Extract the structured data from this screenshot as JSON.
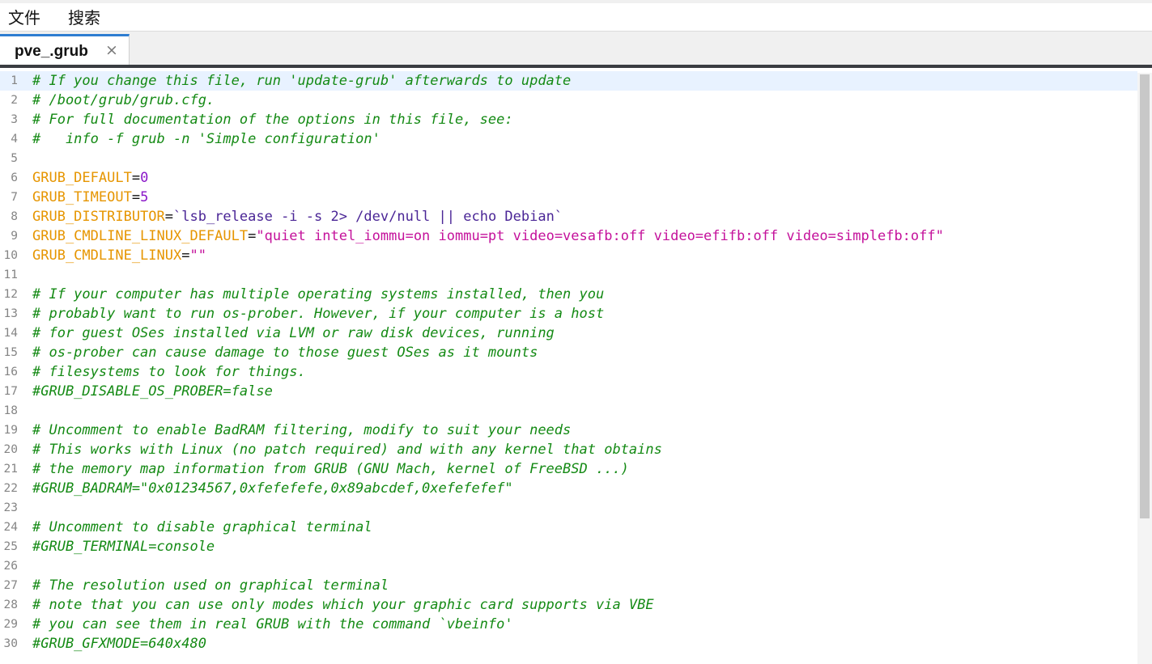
{
  "menu": {
    "file": "文件",
    "search": "搜索"
  },
  "tab": {
    "label": "pve_.grub",
    "close": "×"
  },
  "lines": [
    {
      "n": "1",
      "segs": [
        {
          "t": "# If you change this file, run 'update-grub' afterwards to update",
          "c": "comment"
        }
      ]
    },
    {
      "n": "2",
      "segs": [
        {
          "t": "# /boot/grub/grub.cfg.",
          "c": "comment"
        }
      ]
    },
    {
      "n": "3",
      "segs": [
        {
          "t": "# For full documentation of the options in this file, see:",
          "c": "comment"
        }
      ]
    },
    {
      "n": "4",
      "segs": [
        {
          "t": "#   info -f grub -n 'Simple configuration'",
          "c": "comment"
        }
      ]
    },
    {
      "n": "5",
      "segs": []
    },
    {
      "n": "6",
      "segs": [
        {
          "t": "GRUB_DEFAULT",
          "c": "key"
        },
        {
          "t": "=",
          "c": "op"
        },
        {
          "t": "0",
          "c": "num"
        }
      ]
    },
    {
      "n": "7",
      "segs": [
        {
          "t": "GRUB_TIMEOUT",
          "c": "key"
        },
        {
          "t": "=",
          "c": "op"
        },
        {
          "t": "5",
          "c": "num"
        }
      ]
    },
    {
      "n": "8",
      "segs": [
        {
          "t": "GRUB_DISTRIBUTOR",
          "c": "key"
        },
        {
          "t": "=",
          "c": "op"
        },
        {
          "t": "`lsb_release -i -s 2> /dev/null || echo Debian`",
          "c": "tick"
        }
      ]
    },
    {
      "n": "9",
      "segs": [
        {
          "t": "GRUB_CMDLINE_LINUX_DEFAULT",
          "c": "key"
        },
        {
          "t": "=",
          "c": "op"
        },
        {
          "t": "\"quiet intel_iommu=on iommu=pt video=vesafb:off video=efifb:off video=simplefb:off\"",
          "c": "str"
        }
      ]
    },
    {
      "n": "10",
      "segs": [
        {
          "t": "GRUB_CMDLINE_LINUX",
          "c": "key"
        },
        {
          "t": "=",
          "c": "op"
        },
        {
          "t": "\"\"",
          "c": "str"
        }
      ]
    },
    {
      "n": "11",
      "segs": []
    },
    {
      "n": "12",
      "segs": [
        {
          "t": "# If your computer has multiple operating systems installed, then you",
          "c": "comment"
        }
      ]
    },
    {
      "n": "13",
      "segs": [
        {
          "t": "# probably want to run os-prober. However, if your computer is a host",
          "c": "comment"
        }
      ]
    },
    {
      "n": "14",
      "segs": [
        {
          "t": "# for guest OSes installed via LVM or raw disk devices, running",
          "c": "comment"
        }
      ]
    },
    {
      "n": "15",
      "segs": [
        {
          "t": "# os-prober can cause damage to those guest OSes as it mounts",
          "c": "comment"
        }
      ]
    },
    {
      "n": "16",
      "segs": [
        {
          "t": "# filesystems to look for things.",
          "c": "comment"
        }
      ]
    },
    {
      "n": "17",
      "segs": [
        {
          "t": "#GRUB_DISABLE_OS_PROBER=false",
          "c": "comment"
        }
      ]
    },
    {
      "n": "18",
      "segs": []
    },
    {
      "n": "19",
      "segs": [
        {
          "t": "# Uncomment to enable BadRAM filtering, modify to suit your needs",
          "c": "comment"
        }
      ]
    },
    {
      "n": "20",
      "segs": [
        {
          "t": "# This works with Linux (no patch required) and with any kernel that obtains",
          "c": "comment"
        }
      ]
    },
    {
      "n": "21",
      "segs": [
        {
          "t": "# the memory map information from GRUB (GNU Mach, kernel of FreeBSD ...)",
          "c": "comment"
        }
      ]
    },
    {
      "n": "22",
      "segs": [
        {
          "t": "#GRUB_BADRAM=\"0x01234567,0xfefefefe,0x89abcdef,0xefefefef\"",
          "c": "comment"
        }
      ]
    },
    {
      "n": "23",
      "segs": []
    },
    {
      "n": "24",
      "segs": [
        {
          "t": "# Uncomment to disable graphical terminal",
          "c": "comment"
        }
      ]
    },
    {
      "n": "25",
      "segs": [
        {
          "t": "#GRUB_TERMINAL=console",
          "c": "comment"
        }
      ]
    },
    {
      "n": "26",
      "segs": []
    },
    {
      "n": "27",
      "segs": [
        {
          "t": "# The resolution used on graphical terminal",
          "c": "comment"
        }
      ]
    },
    {
      "n": "28",
      "segs": [
        {
          "t": "# note that you can use only modes which your graphic card supports via VBE",
          "c": "comment"
        }
      ]
    },
    {
      "n": "29",
      "segs": [
        {
          "t": "# you can see them in real GRUB with the command `vbeinfo'",
          "c": "comment"
        }
      ]
    },
    {
      "n": "30",
      "segs": [
        {
          "t": "#GRUB_GFXMODE=640x480",
          "c": "comment"
        }
      ]
    }
  ],
  "colors": {
    "comment": "#148a14",
    "key": "#e69500",
    "number": "#8a16c8",
    "string": "#c4119b",
    "backtick": "#4a2596",
    "tab_accent": "#2e7dd1",
    "current_line": "#e8f2ff"
  }
}
